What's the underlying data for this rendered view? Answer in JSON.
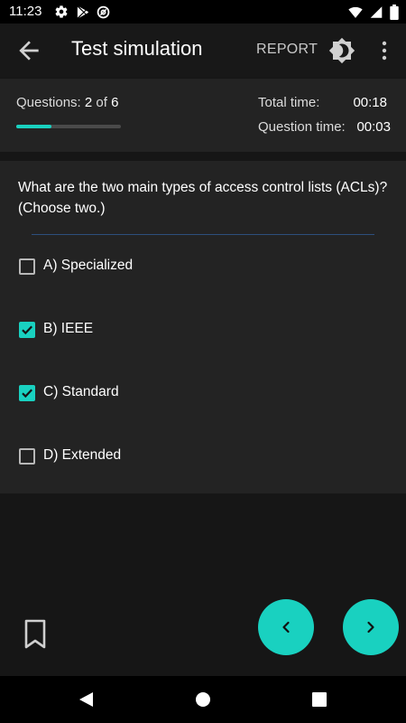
{
  "status_bar": {
    "time": "11:23",
    "left_icons": [
      "gear-icon",
      "play-store-icon",
      "at-sign-icon"
    ],
    "right_icons": [
      "wifi-icon",
      "signal-icon",
      "battery-icon"
    ]
  },
  "app_bar": {
    "title": "Test simulation",
    "report_label": "REPORT",
    "icons": [
      "arrow-left-icon",
      "brightness-icon",
      "more-vert-icon"
    ]
  },
  "progress": {
    "questions_label": "Questions:",
    "current": "2",
    "of_label": "of",
    "total": "6",
    "bar_fraction": 0.333,
    "total_time_label": "Total time:",
    "total_time": "00:18",
    "question_time_label": "Question time:",
    "question_time": "00:03"
  },
  "question": {
    "text": "What are the two main types of access control lists (ACLs)? (Choose two.)",
    "options": [
      {
        "label": "A) Specialized",
        "checked": false
      },
      {
        "label": "B) IEEE",
        "checked": true
      },
      {
        "label": "C) Standard",
        "checked": true
      },
      {
        "label": "D) Extended",
        "checked": false
      }
    ]
  },
  "bottom": {
    "icons": [
      "bookmark-icon",
      "chevron-left-icon",
      "chevron-right-icon"
    ]
  },
  "nav_bar": {
    "icons": [
      "back-triangle-icon",
      "home-circle-icon",
      "recents-square-icon"
    ]
  },
  "colors": {
    "accent": "#19d1c0",
    "background": "#161616",
    "card": "#232323",
    "divider": "#2d4f7c"
  }
}
